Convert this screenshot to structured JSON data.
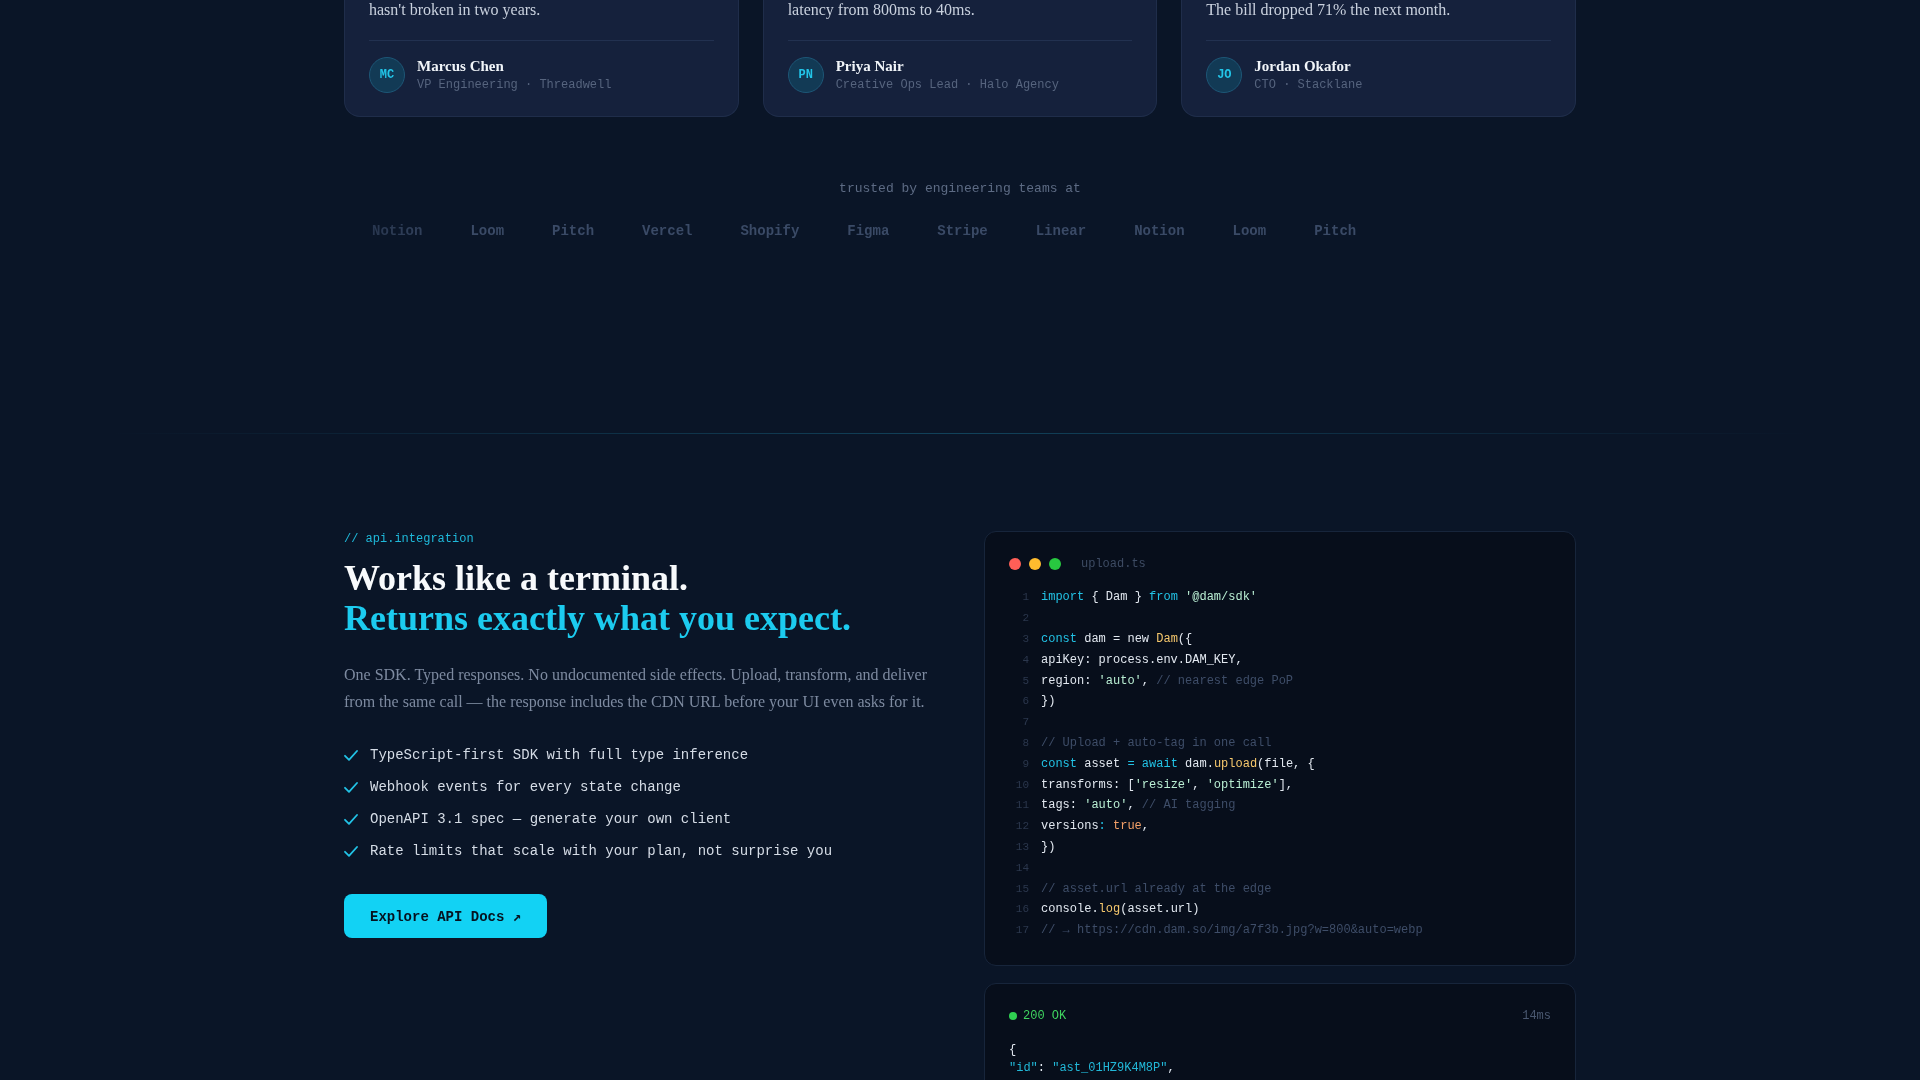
{
  "testimonials": [
    {
      "quote": "hasn't broken in two years.",
      "initials": "MC",
      "name": "Marcus Chen",
      "role": "VP Engineering · Threadwell"
    },
    {
      "quote": "latency from 800ms to 40ms.",
      "initials": "PN",
      "name": "Priya Nair",
      "role": "Creative Ops Lead · Halo Agency"
    },
    {
      "quote": "The bill dropped 71% the next month.",
      "initials": "JO",
      "name": "Jordan Okafor",
      "role": "CTO · Stacklane"
    }
  ],
  "logos": {
    "label": "trusted by engineering teams at",
    "items": [
      "Notion",
      "Loom",
      "Pitch",
      "Vercel",
      "Shopify",
      "Figma",
      "Stripe",
      "Linear",
      "Notion",
      "Loom",
      "Pitch"
    ]
  },
  "integration": {
    "eyebrow": "// api.integration",
    "title": "Works like a terminal.",
    "title_accent": "Returns exactly what you expect.",
    "description": "One SDK. Typed responses. No undocumented side effects. Upload, transform, and deliver from the same call — the response includes the CDN URL before your UI even asks for it.",
    "features": [
      "TypeScript-first SDK with full type inference",
      "Webhook events for every state change",
      "OpenAPI 3.1 spec — generate your own client",
      "Rate limits that scale with your plan, not surprise you"
    ],
    "cta": "Explore API Docs ↗"
  },
  "code_window": {
    "filename": "upload.ts",
    "lines": [
      {
        "number": "1",
        "tokens": [
          {
            "kind": "keyword",
            "text": "import"
          },
          {
            "kind": "plain",
            "text": " { Dam } "
          },
          {
            "kind": "keyword",
            "text": "from"
          },
          {
            "kind": "string",
            "text": " '@dam/sdk'"
          }
        ]
      },
      {
        "number": "2"
      },
      {
        "number": "3",
        "tokens": [
          {
            "kind": "keyword",
            "text": "const"
          },
          {
            "kind": "plain",
            "text": " dam = new "
          },
          {
            "kind": "func",
            "text": "Dam"
          },
          {
            "kind": "plain",
            "text": "({"
          }
        ]
      },
      {
        "number": "4",
        "tokens": [
          {
            "kind": "plain",
            "text": "apiKey: process.env.DAM_KEY,"
          }
        ]
      },
      {
        "number": "5",
        "tokens": [
          {
            "kind": "plain",
            "text": "region: "
          },
          {
            "kind": "string",
            "text": "'auto'"
          },
          {
            "kind": "plain",
            "text": ", "
          },
          {
            "kind": "comment",
            "text": "// nearest edge PoP"
          }
        ]
      },
      {
        "number": "6",
        "tokens": [
          {
            "kind": "plain",
            "text": "})"
          }
        ]
      },
      {
        "number": "7"
      },
      {
        "number": "8",
        "tokens": [
          {
            "kind": "comment",
            "text": "// Upload + auto-tag in one call"
          }
        ]
      },
      {
        "number": "9",
        "tokens": [
          {
            "kind": "keyword",
            "text": "const"
          },
          {
            "kind": "plain",
            "text": " asset "
          },
          {
            "kind": "operator",
            "text": "="
          },
          {
            "kind": "keyword",
            "text": " await"
          },
          {
            "kind": "plain",
            "text": " dam."
          },
          {
            "kind": "func",
            "text": "upload"
          },
          {
            "kind": "plain",
            "text": "(file, {"
          }
        ]
      },
      {
        "number": "10",
        "tokens": [
          {
            "kind": "plain",
            "text": "transforms: ["
          },
          {
            "kind": "string",
            "text": "'resize'"
          },
          {
            "kind": "plain",
            "text": ", "
          },
          {
            "kind": "string",
            "text": "'optimize'"
          },
          {
            "kind": "plain",
            "text": "],"
          }
        ]
      },
      {
        "number": "11",
        "tokens": [
          {
            "kind": "plain",
            "text": "tags: "
          },
          {
            "kind": "string",
            "text": "'auto'"
          },
          {
            "kind": "plain",
            "text": ", "
          },
          {
            "kind": "comment",
            "text": "// AI tagging"
          }
        ]
      },
      {
        "number": "12",
        "tokens": [
          {
            "kind": "plain",
            "text": "versions"
          },
          {
            "kind": "operator",
            "text": ":"
          },
          {
            "kind": "bool",
            "text": " true"
          },
          {
            "kind": "plain",
            "text": ","
          }
        ]
      },
      {
        "number": "13",
        "tokens": [
          {
            "kind": "plain",
            "text": "})"
          }
        ]
      },
      {
        "number": "14"
      },
      {
        "number": "15",
        "tokens": [
          {
            "kind": "comment",
            "text": "// asset.url already at the edge"
          }
        ]
      },
      {
        "number": "16",
        "tokens": [
          {
            "kind": "plain",
            "text": "console."
          },
          {
            "kind": "func",
            "text": "log"
          },
          {
            "kind": "plain",
            "text": "(asset.url)"
          }
        ]
      },
      {
        "number": "17",
        "tokens": [
          {
            "kind": "comment",
            "text": "// → https://cdn.dam.so/img/a7f3b.jpg?w=800&auto=webp"
          }
        ]
      }
    ]
  },
  "response": {
    "status": "200 OK",
    "time": "14ms",
    "lines": [
      {
        "tokens": [
          {
            "kind": "plain",
            "text": "{"
          }
        ]
      },
      {
        "tokens": [
          {
            "kind": "key",
            "text": "\"id\""
          },
          {
            "kind": "plain",
            "text": ": "
          },
          {
            "kind": "value",
            "text": "\"ast_01HZ9K4M8P\""
          },
          {
            "kind": "plain",
            "text": ","
          }
        ]
      }
    ]
  }
}
